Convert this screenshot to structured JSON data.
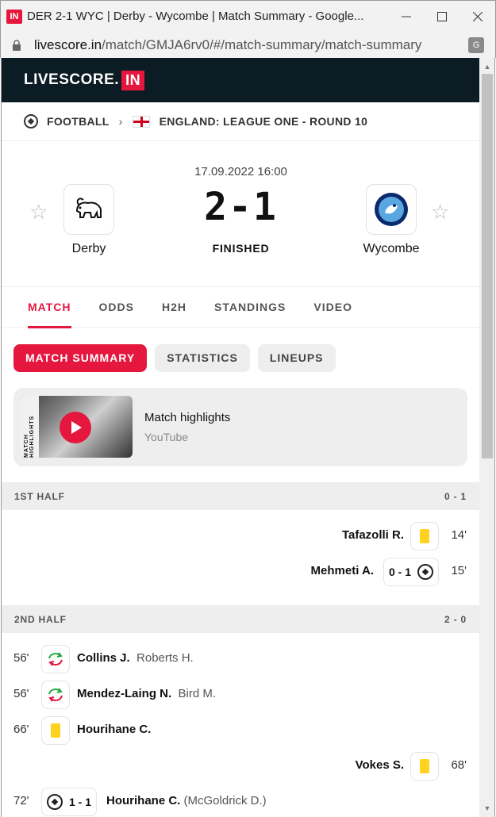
{
  "window": {
    "icon_text": "IN",
    "title": "DER 2-1 WYC | Derby - Wycombe | Match Summary - Google...",
    "url_host": "livescore.in",
    "url_path": "/match/GMJA6rv0/#/match-summary/match-summary"
  },
  "site": {
    "logo_text": "LIVESCORE.",
    "logo_badge": "IN"
  },
  "breadcrumb": {
    "sport": "FOOTBALL",
    "competition": "ENGLAND: LEAGUE ONE - ROUND 10"
  },
  "match": {
    "datetime": "17.09.2022 16:00",
    "home": "Derby",
    "away": "Wycombe",
    "score": "2-1",
    "status": "FINISHED"
  },
  "tabs": [
    "MATCH",
    "ODDS",
    "H2H",
    "STANDINGS",
    "VIDEO"
  ],
  "subtabs": [
    "MATCH SUMMARY",
    "STATISTICS",
    "LINEUPS"
  ],
  "highlight": {
    "title": "Match highlights",
    "source": "YouTube",
    "thumb_text": "MATCH HIGHLIGHTS"
  },
  "periods": [
    {
      "name": "1ST HALF",
      "score": "0 - 1"
    },
    {
      "name": "2ND HALF",
      "score": "2 - 0"
    }
  ],
  "events_first": [
    {
      "minute": "14'",
      "player": "Tafazolli R.",
      "type": "yellow-card",
      "side": "away"
    },
    {
      "minute": "15'",
      "player": "Mehmeti A.",
      "score": "0 - 1",
      "type": "goal",
      "side": "away"
    }
  ],
  "events_second": [
    {
      "minute": "56'",
      "player": "Collins J.",
      "assist": "Roberts H.",
      "type": "substitution",
      "side": "home"
    },
    {
      "minute": "56'",
      "player": "Mendez-Laing N.",
      "assist": "Bird M.",
      "type": "substitution",
      "side": "home"
    },
    {
      "minute": "66'",
      "player": "Hourihane C.",
      "type": "yellow-card",
      "side": "home"
    },
    {
      "minute": "68'",
      "player": "Vokes S.",
      "type": "yellow-card",
      "side": "away"
    },
    {
      "minute": "72'",
      "player": "Hourihane C.",
      "assist": "(McGoldrick D.)",
      "score": "1 - 1",
      "type": "goal",
      "side": "home"
    }
  ]
}
